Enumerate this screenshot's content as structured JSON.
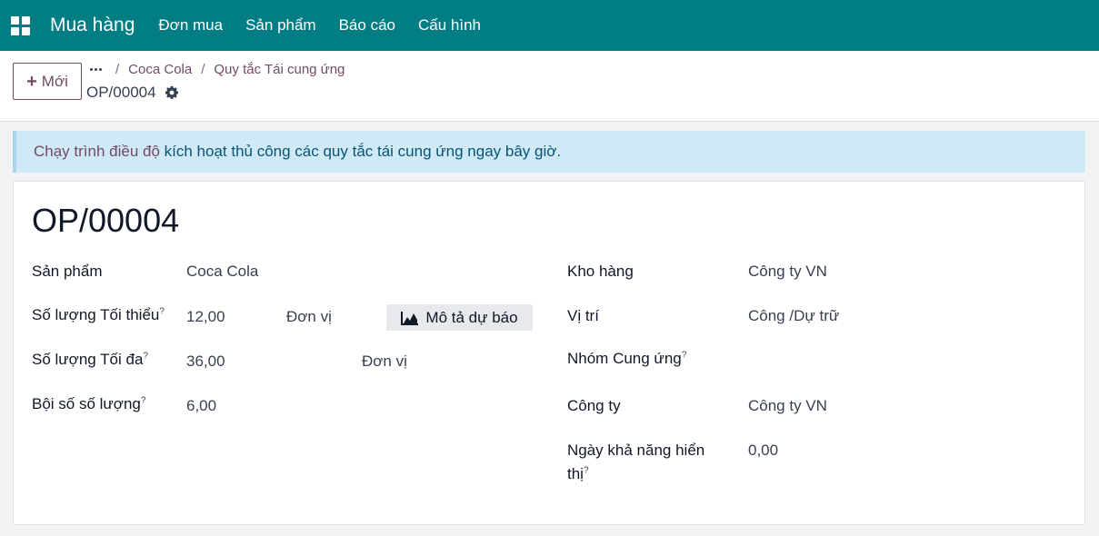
{
  "navbar": {
    "app_name": "Mua hàng",
    "items": [
      "Đơn mua",
      "Sản phẩm",
      "Báo cáo",
      "Cấu hình"
    ]
  },
  "control": {
    "new_button_label": "Mới",
    "breadcrumb": [
      "Coca Cola",
      "Quy tắc Tái cung ứng"
    ],
    "record_name": "OP/00004"
  },
  "alert": {
    "link_text": "Chạy trình điều độ",
    "rest_text": " kích hoạt thủ công các quy tắc tái cung ứng ngay bây giờ."
  },
  "form": {
    "title": "OP/00004",
    "left": {
      "product_label": "Sản phẩm",
      "product_value": "Coca Cola",
      "min_qty_label": "Số lượng Tối thiểu",
      "min_qty_value": "12,00",
      "min_qty_uom": "Đơn vị",
      "max_qty_label": "Số lượng Tối đa",
      "max_qty_value": "36,00",
      "max_qty_uom": "Đơn vị",
      "multiple_label": "Bội số số lượng",
      "multiple_value": "6,00"
    },
    "forecast_button": "Mô tả dự báo",
    "right": {
      "warehouse_label": "Kho hàng",
      "warehouse_value": "Công ty VN",
      "location_label": "Vị trí",
      "location_value": "Công /Dự trữ",
      "group_label": "Nhóm Cung ứng",
      "company_label": "Công ty",
      "company_value": "Công ty VN",
      "visibility_label_1": "Ngày khả năng hiển",
      "visibility_label_2": "thị",
      "visibility_value": "0,00"
    },
    "help_mark": "?"
  },
  "colors": {
    "navbar": "#017e84",
    "accent": "#714b67",
    "alert_bg": "#cfe9f7"
  }
}
